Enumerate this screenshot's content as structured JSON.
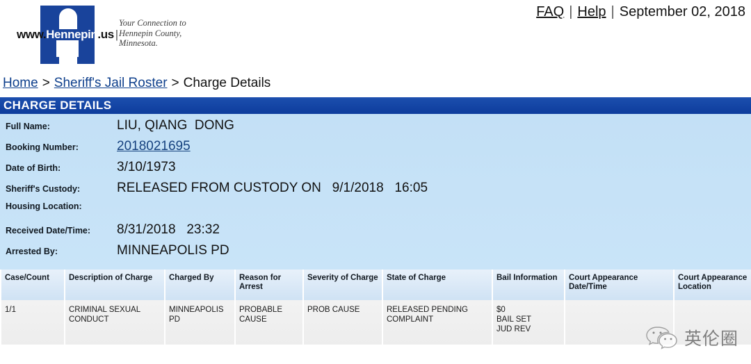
{
  "header": {
    "logo_url_prefix": "www.",
    "logo_url_brand": "Hennepin",
    "logo_url_suffix": ".us",
    "logo_tagline_line1": "Your Connection to",
    "logo_tagline_line2": "Hennepin County,",
    "logo_tagline_line3": "Minnesota.",
    "faq_label": "FAQ",
    "help_label": "Help",
    "date": "September 02, 2018",
    "separator": "|"
  },
  "breadcrumb": {
    "home": "Home",
    "roster": "Sheriff's Jail Roster",
    "current": "Charge Details",
    "separator": ">"
  },
  "section": {
    "title": "CHARGE DETAILS"
  },
  "details": {
    "rows": [
      {
        "label": "Full Name:",
        "value": "LIU, QIANG  DONG",
        "link": false
      },
      {
        "label": "Booking Number:",
        "value": "2018021695",
        "link": true
      },
      {
        "label": "Date of Birth:",
        "value": "3/10/1973",
        "link": false
      },
      {
        "label": "Sheriff's Custody:",
        "value": "RELEASED FROM CUSTODY ON   9/1/2018   16:05",
        "link": false
      },
      {
        "label": "Housing Location:",
        "value": "",
        "link": false
      },
      {
        "label": "Received Date/Time:",
        "value": "8/31/2018   23:32",
        "link": false
      },
      {
        "label": "Arrested By:",
        "value": "MINNEAPOLIS PD",
        "link": false
      }
    ]
  },
  "charge_table": {
    "columns": [
      "Case/Count",
      "Description of Charge",
      "Charged By",
      "Reason for Arrest",
      "Severity of Charge",
      "State of Charge",
      "Bail Information",
      "Court Appearance Date/Time",
      "Court Appearance Location"
    ],
    "rows": [
      {
        "case_count": [
          "1/1"
        ],
        "description": [
          "CRIMINAL SEXUAL",
          "CONDUCT"
        ],
        "charged_by": [
          "MINNEAPOLIS",
          "PD"
        ],
        "reason": [
          "PROBABLE",
          "CAUSE"
        ],
        "severity": [
          "PROB CAUSE"
        ],
        "state": [
          "RELEASED PENDING",
          "COMPLAINT"
        ],
        "bail": [
          "$0",
          "BAIL SET",
          "JUD REV"
        ],
        "court_datetime": [],
        "court_location": []
      }
    ]
  },
  "watermark": {
    "text": "英伦圈"
  },
  "colors": {
    "banner_blue": "#0d3c9c",
    "logo_blue": "#19439b",
    "panel_blue": "#c6e2f7",
    "link_blue": "#0e3f8c",
    "table_header": "#d7e7f5",
    "table_cell": "#f0f0f0"
  }
}
